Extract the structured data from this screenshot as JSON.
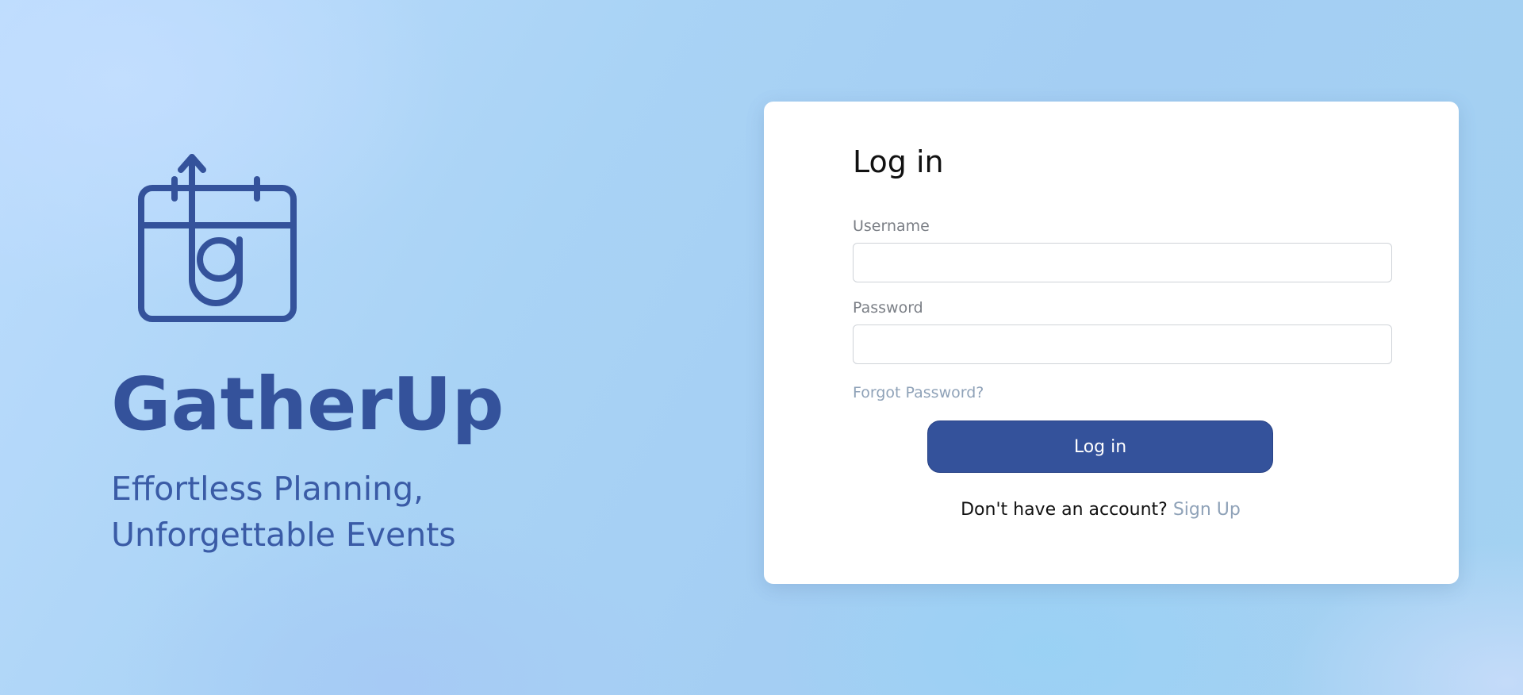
{
  "brand": {
    "logo_icon": "calendar-upload-g-icon",
    "name": "GatherUp",
    "tagline": "Effortless Planning, Unforgettable Events",
    "color": "#34529b"
  },
  "login": {
    "title": "Log in",
    "username_label": "Username",
    "username_value": "",
    "password_label": "Password",
    "password_value": "",
    "forgot_label": "Forgot Password?",
    "submit_label": "Log in",
    "signup_prompt": "Don't have an account?",
    "signup_link": "Sign Up"
  },
  "colors": {
    "primary": "#34529b",
    "link": "#8fa2b8",
    "card_background": "#ffffff"
  }
}
